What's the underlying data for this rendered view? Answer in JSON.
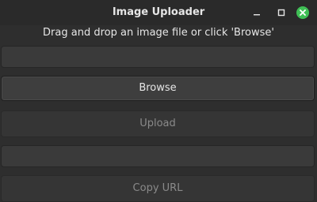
{
  "window": {
    "title": "Image Uploader"
  },
  "instruction": "Drag and drop an image file or click 'Browse'",
  "file_path_field": {
    "value": ""
  },
  "buttons": {
    "browse_label": "Browse",
    "upload_label": "Upload",
    "copy_url_label": "Copy URL"
  },
  "url_field": {
    "value": ""
  },
  "colors": {
    "close_button": "#3fbf55",
    "background": "#2e2e2e"
  },
  "icons": {
    "minimize": "minimize-icon",
    "maximize": "maximize-icon",
    "close": "close-icon"
  }
}
